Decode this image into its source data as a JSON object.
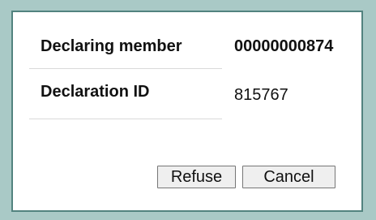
{
  "declaration": {
    "rows": [
      {
        "label": "Declaring member",
        "value": "00000000874"
      },
      {
        "label": "Declaration ID",
        "value": "815767"
      }
    ]
  },
  "actions": {
    "refuse_label": "Refuse",
    "cancel_label": "Cancel"
  }
}
